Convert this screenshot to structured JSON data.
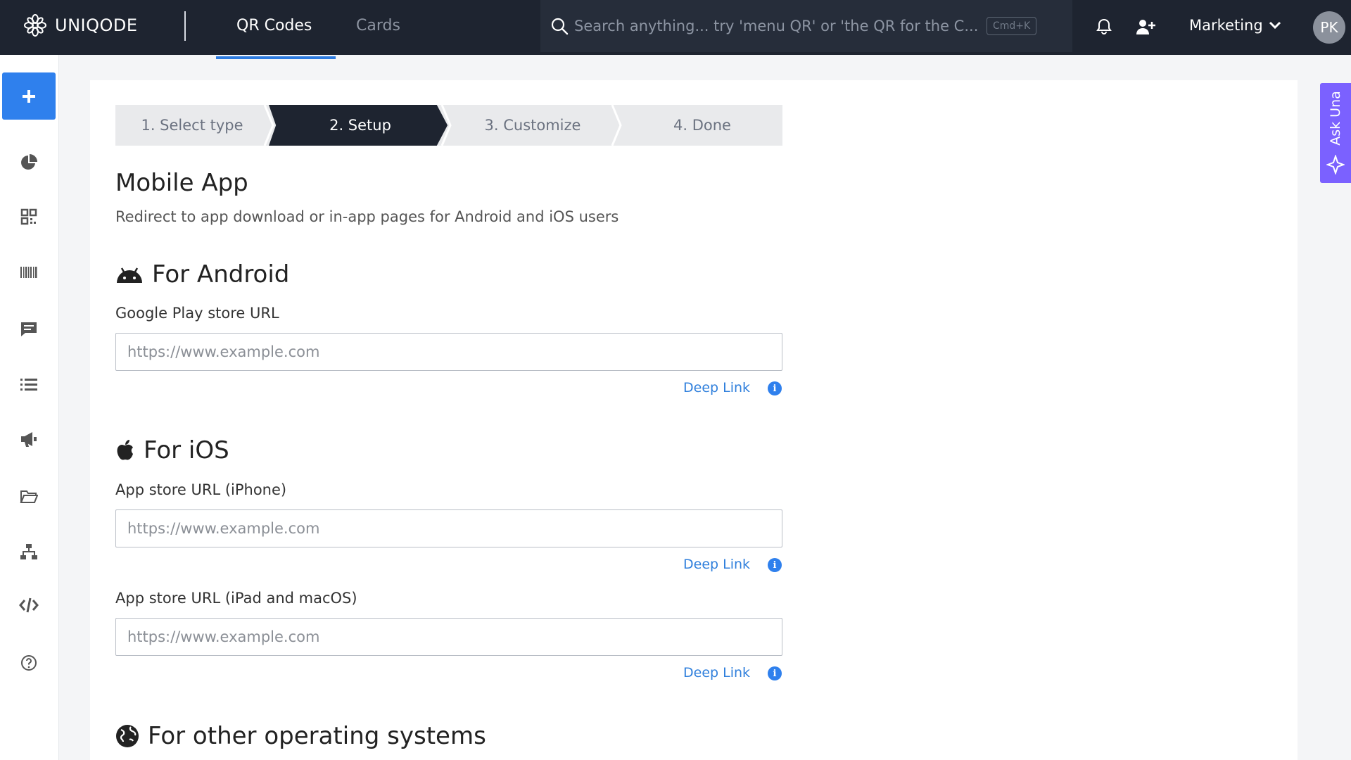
{
  "app": {
    "brand": "UNIQODE"
  },
  "nav": {
    "tabs": [
      {
        "label": "QR Codes"
      },
      {
        "label": "Cards"
      }
    ]
  },
  "search": {
    "placeholder": "Search anything... try 'menu QR' or 'the QR for the C...",
    "shortcut": "Cmd+K"
  },
  "header": {
    "workspace": "Marketing",
    "avatar_initials": "PK"
  },
  "stepper": {
    "steps": [
      {
        "label": "1. Select type"
      },
      {
        "label": "2. Setup"
      },
      {
        "label": "3. Customize"
      },
      {
        "label": "4. Done"
      }
    ],
    "active_index": 1
  },
  "page": {
    "title": "Mobile App",
    "subtitle": "Redirect to app download or in-app pages for Android and iOS users"
  },
  "android": {
    "heading": "For Android",
    "field_label": "Google Play store URL",
    "placeholder": "https://www.example.com",
    "deep_link": "Deep Link"
  },
  "ios": {
    "heading": "For iOS",
    "iphone_label": "App store URL (iPhone)",
    "iphone_placeholder": "https://www.example.com",
    "iphone_deep_link": "Deep Link",
    "ipad_label": "App store URL (iPad and macOS)",
    "ipad_placeholder": "https://www.example.com",
    "ipad_deep_link": "Deep Link"
  },
  "other": {
    "heading": "For other operating systems"
  },
  "assistant": {
    "label": "Ask Una"
  },
  "sidebar_icons": [
    "add-icon",
    "analytics-icon",
    "qr-codes-icon",
    "barcode-icon",
    "forms-icon",
    "list-icon",
    "campaign-icon",
    "folder-icon",
    "network-icon",
    "developer-icon",
    "help-icon"
  ],
  "colors": {
    "topbar": "#1e2430",
    "accent": "#2f80ed",
    "assistant": "#7b61ff",
    "link": "#2f7fdc"
  }
}
